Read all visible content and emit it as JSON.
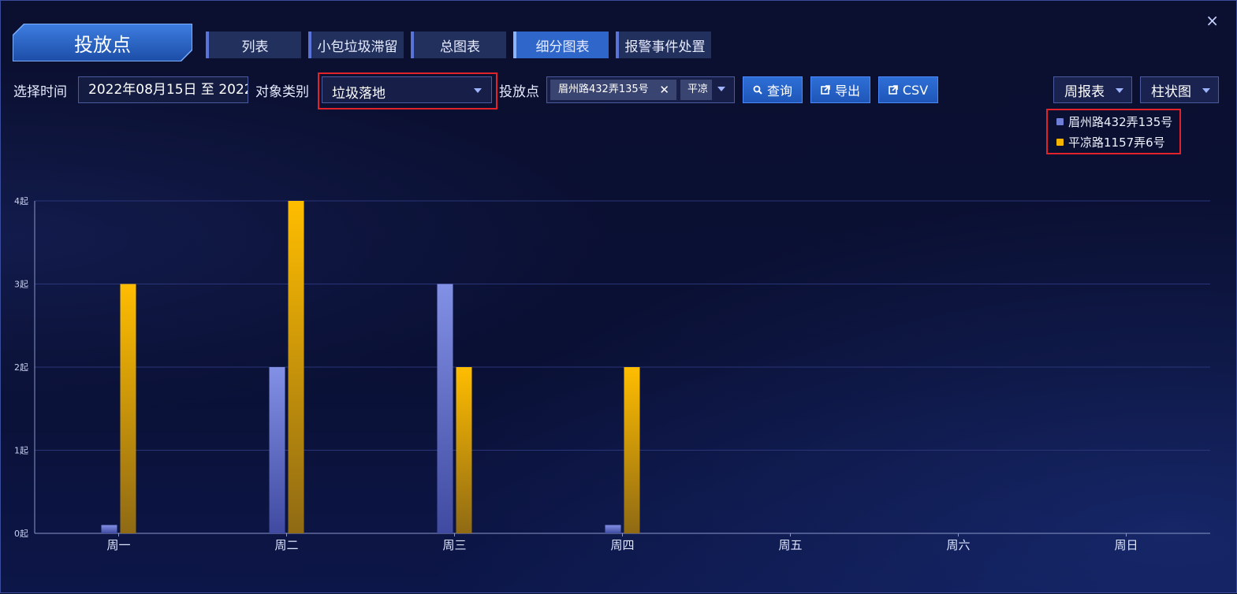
{
  "window": {
    "close_label": "×"
  },
  "title_tab": "投放点",
  "tabs": [
    {
      "label": "列表"
    },
    {
      "label": "小包垃圾滞留"
    },
    {
      "label": "总图表"
    },
    {
      "label": "细分图表",
      "active": true
    },
    {
      "label": "报警事件处置"
    }
  ],
  "filters": {
    "time_label": "选择时间",
    "time_value": "2022年08月15日 至 2022",
    "object_label": "对象类别",
    "object_value": "垃圾落地",
    "point_label": "投放点",
    "point_chips": [
      "眉州路432弄135号",
      "平凉"
    ],
    "chip_remove": "✕"
  },
  "buttons": {
    "query": "查询",
    "export": "导出",
    "csv": "CSV"
  },
  "report_dropdown": "周报表",
  "chart_dropdown": "柱状图",
  "colors": {
    "series1": "#6f7fd8",
    "series2": "#f5b400",
    "accent": "#2f66c9",
    "highlight": "#e0232b"
  },
  "chart_data": {
    "type": "bar",
    "categories": [
      "周一",
      "周二",
      "周三",
      "周四",
      "周五",
      "周六",
      "周日"
    ],
    "series": [
      {
        "name": "眉州路432弄135号",
        "values": [
          0.1,
          2,
          3,
          0.1,
          0,
          0,
          0
        ]
      },
      {
        "name": "平凉路1157弄6号",
        "values": [
          3,
          4,
          2,
          2,
          0,
          0,
          0
        ]
      }
    ],
    "yticks": [
      "0起",
      "1起",
      "2起",
      "3起",
      "4起"
    ],
    "ylim": [
      0,
      4
    ],
    "grid": true,
    "legend_position": "top-right"
  }
}
